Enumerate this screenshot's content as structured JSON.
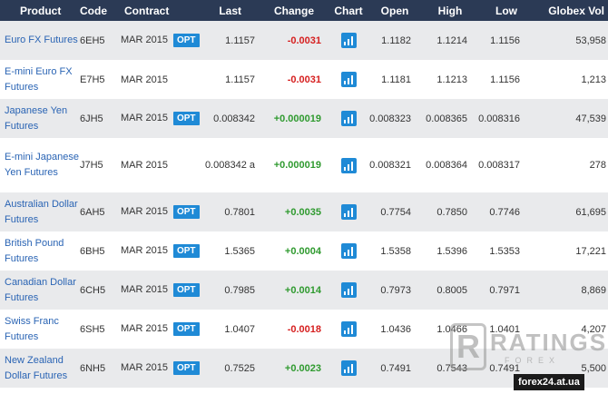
{
  "columns": {
    "product": "Product",
    "code": "Code",
    "contract": "Contract",
    "last": "Last",
    "change": "Change",
    "chart": "Chart",
    "open": "Open",
    "high": "High",
    "low": "Low",
    "vol": "Globex Vol"
  },
  "colors": {
    "header_bg": "#2b3a55",
    "link": "#2a64b4",
    "opt_badge": "#1f8ad6",
    "negative": "#d62020",
    "positive": "#2f9a2f"
  },
  "opt_label": "OPT",
  "rows": [
    {
      "product": "Euro FX Futures",
      "code": "6EH5",
      "contract": "MAR 2015",
      "opt": true,
      "last": "1.1157",
      "change": "-0.0031",
      "dir": "neg",
      "open": "1.1182",
      "high": "1.1214",
      "low": "1.1156",
      "vol": "53,958"
    },
    {
      "product": "E-mini Euro FX Futures",
      "code": "E7H5",
      "contract": "MAR 2015",
      "opt": false,
      "last": "1.1157",
      "change": "-0.0031",
      "dir": "neg",
      "open": "1.1181",
      "high": "1.1213",
      "low": "1.1156",
      "vol": "1,213"
    },
    {
      "product": "Japanese Yen Futures",
      "code": "6JH5",
      "contract": "MAR 2015",
      "opt": true,
      "last": "0.008342",
      "change": "+0.000019",
      "dir": "pos",
      "open": "0.008323",
      "high": "0.008365",
      "low": "0.008316",
      "vol": "47,539"
    },
    {
      "product": "E-mini Japanese Yen Futures",
      "code": "J7H5",
      "contract": "MAR 2015",
      "opt": false,
      "last": "0.008342 a",
      "change": "+0.000019",
      "dir": "pos",
      "open": "0.008321",
      "high": "0.008364",
      "low": "0.008317",
      "vol": "278"
    },
    {
      "product": "Australian Dollar Futures",
      "code": "6AH5",
      "contract": "MAR 2015",
      "opt": true,
      "last": "0.7801",
      "change": "+0.0035",
      "dir": "pos",
      "open": "0.7754",
      "high": "0.7850",
      "low": "0.7746",
      "vol": "61,695"
    },
    {
      "product": "British Pound Futures",
      "code": "6BH5",
      "contract": "MAR 2015",
      "opt": true,
      "last": "1.5365",
      "change": "+0.0004",
      "dir": "pos",
      "open": "1.5358",
      "high": "1.5396",
      "low": "1.5353",
      "vol": "17,221"
    },
    {
      "product": "Canadian Dollar Futures",
      "code": "6CH5",
      "contract": "MAR 2015",
      "opt": true,
      "last": "0.7985",
      "change": "+0.0014",
      "dir": "pos",
      "open": "0.7973",
      "high": "0.8005",
      "low": "0.7971",
      "vol": "8,869"
    },
    {
      "product": "Swiss Franc Futures",
      "code": "6SH5",
      "contract": "MAR 2015",
      "opt": true,
      "last": "1.0407",
      "change": "-0.0018",
      "dir": "neg",
      "open": "1.0436",
      "high": "1.0466",
      "low": "1.0401",
      "vol": "4,207"
    },
    {
      "product": "New Zealand Dollar Futures",
      "code": "6NH5",
      "contract": "MAR 2015",
      "opt": true,
      "last": "0.7525",
      "change": "+0.0023",
      "dir": "pos",
      "open": "0.7491",
      "high": "0.7543",
      "low": "0.7491",
      "vol": "5,500"
    }
  ],
  "watermark": {
    "letter": "R",
    "word": "RATINGS",
    "sub": "FOREX"
  },
  "site_label": "forex24.at.ua"
}
